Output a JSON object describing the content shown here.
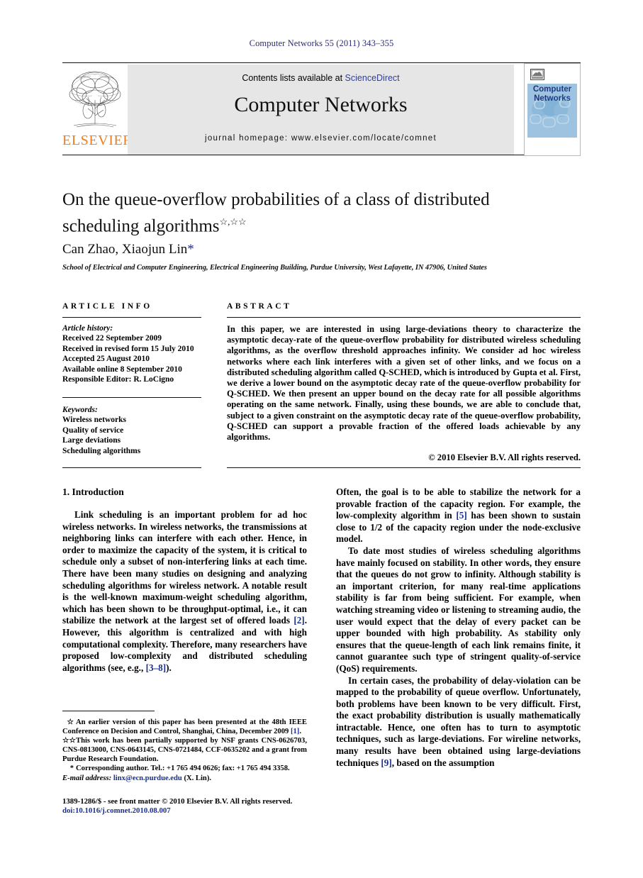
{
  "running_head": "Computer Networks 55 (2011) 343–355",
  "masthead": {
    "contents_prefix": "Contents lists available at ",
    "sciencedirect": "ScienceDirect",
    "journal_title": "Computer Networks",
    "homepage": "journal homepage: www.elsevier.com/locate/comnet",
    "publisher_name": "ELSEVIER",
    "cover": {
      "line1_a": "Com",
      "line1_b": "puter",
      "line2_a": "Net",
      "line2_b": "works"
    }
  },
  "article": {
    "title": "On the queue-overflow probabilities of a class of distributed scheduling algorithms",
    "title_footnote_marks": "☆,☆☆",
    "authors": "Can Zhao, Xiaojun Lin",
    "corresponding_mark": "*",
    "affiliation": "School of Electrical and Computer Engineering, Electrical Engineering Building, Purdue University, West Lafayette, IN 47906, United States"
  },
  "info": {
    "heading": "ARTICLE INFO",
    "history_heading": "Article history:",
    "history": [
      "Received 22 September 2009",
      "Received in revised form 15 July 2010",
      "Accepted 25 August 2010",
      "Available online 8 September 2010",
      "Responsible Editor: R. LoCigno"
    ],
    "keywords_heading": "Keywords:",
    "keywords": [
      "Wireless networks",
      "Quality of service",
      "Large deviations",
      "Scheduling algorithms"
    ]
  },
  "abstract": {
    "heading": "ABSTRACT",
    "text": "In this paper, we are interested in using large-deviations theory to characterize the asymptotic decay-rate of the queue-overflow probability for distributed wireless scheduling algorithms, as the overflow threshold approaches infinity. We consider ad hoc wireless networks where each link interferes with a given set of other links, and we focus on a distributed scheduling algorithm called Q-SCHED, which is introduced by Gupta et al. First, we derive a lower bound on the asymptotic decay rate of the queue-overflow probability for Q-SCHED. We then present an upper bound on the decay rate for all possible algorithms operating on the same network. Finally, using these bounds, we are able to conclude that, subject to a given constraint on the asymptotic decay rate of the queue-overflow probability, Q-SCHED can support a provable fraction of the offered loads achievable by any algorithms.",
    "copyright": "© 2010 Elsevier B.V. All rights reserved."
  },
  "body": {
    "section_number_title": "1. Introduction",
    "left_paragraphs": [
      {
        "segments": [
          {
            "t": "Link scheduling is an important problem for ad hoc wireless networks. In wireless networks, the transmissions at neighboring links can interfere with each other. Hence, in order to maximize the capacity of the system, it is critical to schedule only a subset of non-interfering links at each time. There have been many studies on designing and analyzing scheduling algorithms for wireless network. A notable result is the well-known maximum-weight scheduling algorithm, which has been shown to be throughput-optimal, i.e., it can stabilize the network at the largest set of offered loads "
          },
          {
            "t": "[2]",
            "ref": true
          },
          {
            "t": ". However, this algorithm is centralized and with high computational complexity. Therefore, many researchers have proposed low-complexity and distributed scheduling algorithms (see, e.g., "
          },
          {
            "t": "[3–8]",
            "ref": true
          },
          {
            "t": ")."
          }
        ]
      }
    ],
    "right_paragraphs": [
      {
        "no_indent": true,
        "segments": [
          {
            "t": "Often, the goal is to be able to stabilize the network for a provable fraction of the capacity region. For example, the low-complexity algorithm in "
          },
          {
            "t": "[5]",
            "ref": true
          },
          {
            "t": " has been shown to sustain close to 1/2 of the capacity region under the node-exclusive model."
          }
        ]
      },
      {
        "segments": [
          {
            "t": "To date most studies of wireless scheduling algorithms have mainly focused on stability. In other words, they ensure that the queues do not grow to infinity. Although stability is an important criterion, for many real-time applications stability is far from being sufficient. For example, when watching streaming video or listening to streaming audio, the user would expect that the delay of every packet can be upper bounded with high probability. As stability only ensures that the queue-length of each link remains finite, it cannot guarantee such type of stringent quality-of-service (QoS) requirements."
          }
        ]
      },
      {
        "segments": [
          {
            "t": "In certain cases, the probability of delay-violation can be mapped to the probability of queue overflow. Unfortunately, both problems have been known to be very difficult. First, the exact probability distribution is usually mathematically intractable. Hence, one often has to turn to asymptotic techniques, such as large-deviations. For wireline networks, many results have been obtained using large-deviations techniques "
          },
          {
            "t": "[9]",
            "ref": true
          },
          {
            "t": ", based on the assumption"
          }
        ]
      }
    ]
  },
  "footnotes": [
    {
      "mark": "☆",
      "segments": [
        {
          "t": "An earlier version of this paper has been presented at the 48th IEEE Conference on Decision and Control, Shanghai, China, December 2009 "
        },
        {
          "t": "[1]",
          "ref": true
        },
        {
          "t": "."
        }
      ]
    },
    {
      "mark": "☆☆",
      "segments": [
        {
          "t": "This work has been partially supported by NSF grants CNS-0626703, CNS-0813000, CNS-0643145, CNS-0721484, CCF-0635202 and a grant from Purdue Research Foundation."
        }
      ]
    },
    {
      "mark": "*",
      "segments": [
        {
          "t": "Corresponding author. Tel.: +1 765 494 0626; fax: +1 765 494 3358."
        }
      ]
    },
    {
      "mark": "",
      "segments": [
        {
          "t": "E-mail address: ",
          "italic": true
        },
        {
          "t": "linx@ecn.purdue.edu",
          "email": true
        },
        {
          "t": " (X. Lin)."
        }
      ]
    }
  ],
  "imprint": {
    "issn_line": "1389-1286/$ - see front matter © 2010 Elsevier B.V. All rights reserved.",
    "doi_prefix": "doi:",
    "doi": "10.1016/j.comnet.2010.08.007"
  }
}
